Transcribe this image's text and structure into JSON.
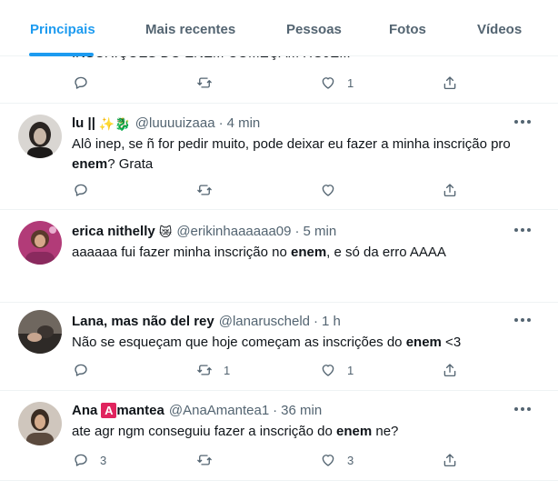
{
  "tabs": [
    {
      "label": "Principais",
      "active": true
    },
    {
      "label": "Mais recentes",
      "active": false
    },
    {
      "label": "Pessoas",
      "active": false
    },
    {
      "label": "Fotos",
      "active": false
    },
    {
      "label": "Vídeos",
      "active": false
    }
  ],
  "colors": {
    "accent": "#1d9bf0",
    "secondary_text": "#536471",
    "primary_text": "#0f1419",
    "divider": "#eff3f4"
  },
  "top_tweet": {
    "text": "INSCRIÇÕES DO ENEM COMEÇAM HOJE!!!",
    "actions": {
      "reply": "",
      "retweet": "",
      "like": "1"
    }
  },
  "tweets": [
    {
      "name": "lu ||",
      "emoji": "✨🐉",
      "handle": "@luuuuizaaa",
      "time": "4 min",
      "text_parts": [
        "Alô inep, se ñ for pedir muito, pode deixar eu fazer a minha inscrição pro ",
        "enem",
        "? Grata"
      ],
      "actions": {
        "reply": "",
        "retweet": "",
        "like": ""
      }
    },
    {
      "name": "erica nithelly",
      "emoji": "😿",
      "handle": "@erikinhaaaaaa09",
      "time": "5 min",
      "text_parts": [
        "aaaaaa fui fazer minha inscrição no ",
        "enem",
        ", e só da erro AAAA"
      ],
      "actions": {
        "reply": "",
        "retweet": "",
        "like": ""
      }
    },
    {
      "name": "Lana, mas não del rey",
      "emoji": "",
      "handle": "@lanaruscheld",
      "time": "1 h",
      "text_parts": [
        "Não se esqueçam que hoje começam as inscrições do ",
        "enem",
        " <3"
      ],
      "actions": {
        "reply": "",
        "retweet": "1",
        "like": "1"
      }
    },
    {
      "name": "Ana",
      "badge": "A",
      "name_suffix": "mantea",
      "handle": "@AnaAmantea1",
      "time": "36 min",
      "text_parts": [
        "ate agr ngm conseguiu fazer a inscrição do ",
        "enem",
        " ne?"
      ],
      "actions": {
        "reply": "3",
        "retweet": "",
        "like": "3"
      }
    }
  ]
}
